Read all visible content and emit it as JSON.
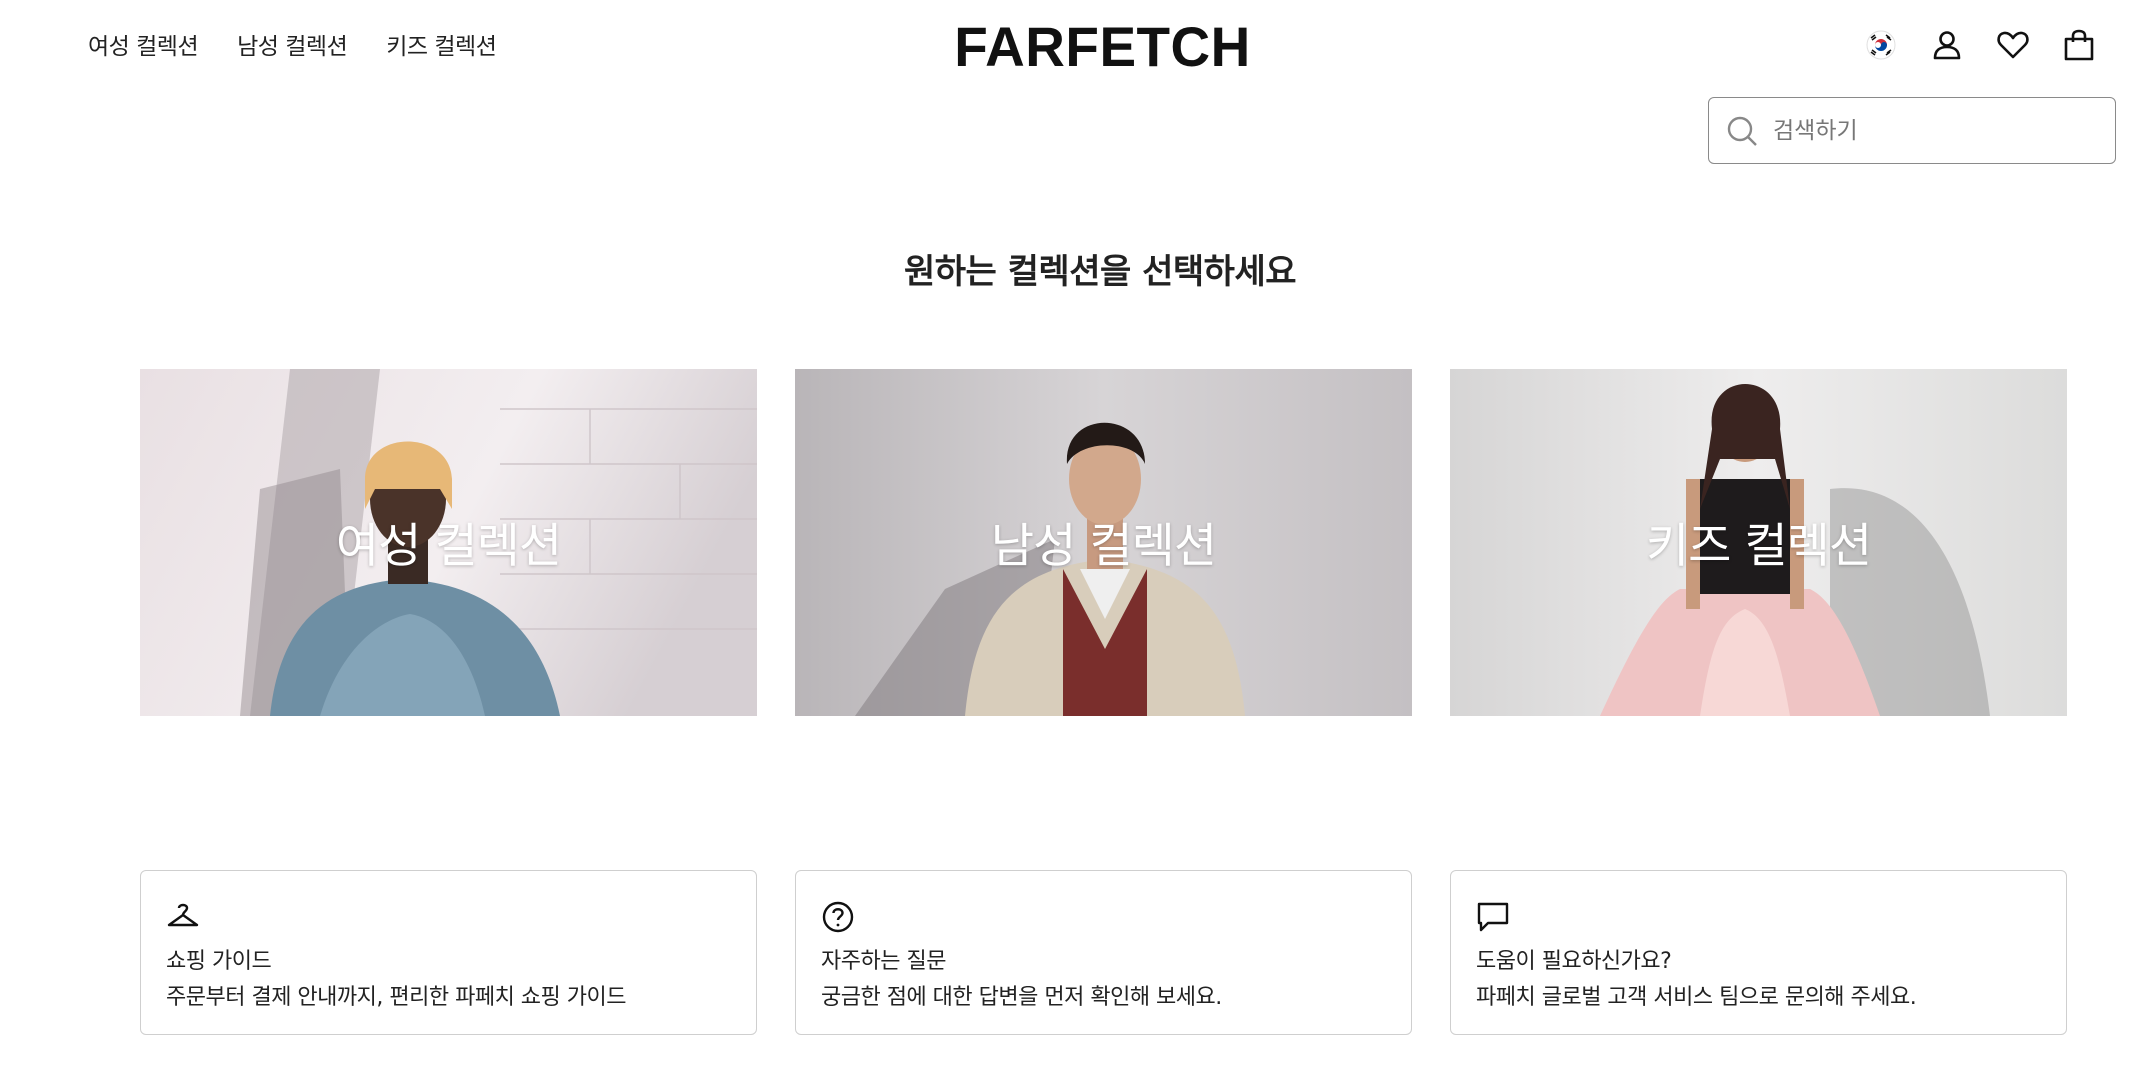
{
  "header": {
    "nav": [
      "여성 컬렉션",
      "남성 컬렉션",
      "키즈 컬렉션"
    ],
    "logo": "FARFETCH",
    "icons": [
      "korea-flag-icon",
      "account-icon",
      "wishlist-heart-icon",
      "shopping-bag-icon"
    ]
  },
  "search": {
    "placeholder": "검색하기",
    "value": ""
  },
  "headline": "원하는 컬렉션을 선택하세요",
  "collections": [
    {
      "label": "여성 컬렉션"
    },
    {
      "label": "남성 컬렉션"
    },
    {
      "label": "키즈 컬렉션"
    }
  ],
  "info_cards": [
    {
      "icon": "hanger-icon",
      "title": "쇼핑 가이드",
      "text": "주문부터 결제 안내까지, 편리한 파페치 쇼핑 가이드"
    },
    {
      "icon": "question-circle-icon",
      "title": "자주하는 질문",
      "text": "궁금한 점에 대한 답변을 먼저 확인해 보세요."
    },
    {
      "icon": "chat-bubble-icon",
      "title": "도움이 필요하신가요?",
      "text": "파페치 글로벌 고객 서비스 팀으로 문의해 주세요."
    }
  ],
  "colors": {
    "text": "#222222",
    "border": "#cfcfcf",
    "background": "#ffffff"
  }
}
